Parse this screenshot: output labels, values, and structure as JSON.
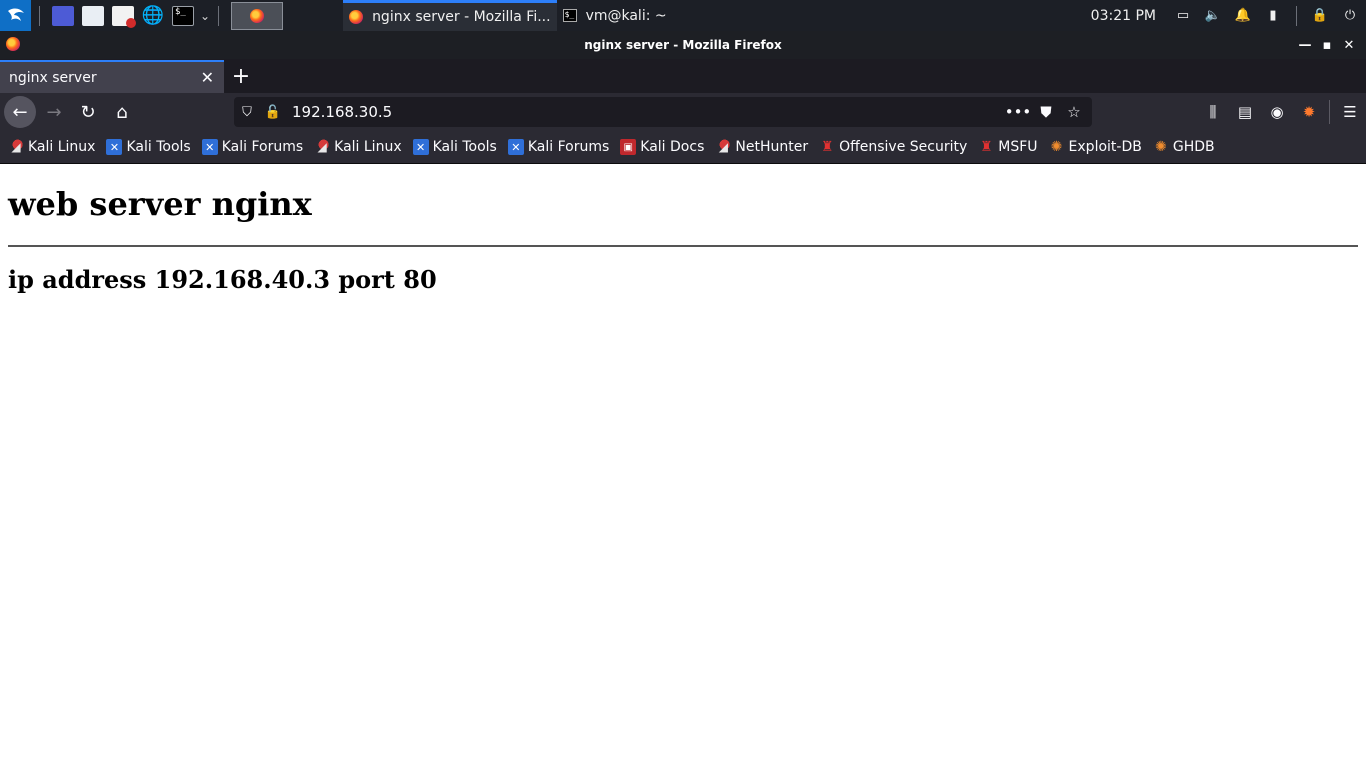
{
  "taskbar": {
    "tasks": [
      {
        "label": "nginx server - Mozilla Fi...",
        "icon": "firefox-icon",
        "active": true
      },
      {
        "label": "vm@kali: ~",
        "icon": "terminal-icon",
        "active": false
      }
    ],
    "clock": "03:21 PM",
    "accent_color": "#2d7ff9"
  },
  "window": {
    "title": "nginx server - Mozilla Firefox"
  },
  "tabs": [
    {
      "label": "nginx server"
    }
  ],
  "navbar": {
    "url": "192.168.30.5"
  },
  "bookmarks": [
    {
      "label": "Kali Linux",
      "icon": "kali-icon"
    },
    {
      "label": "Kali Tools",
      "icon": "kali-tools-icon"
    },
    {
      "label": "Kali Forums",
      "icon": "kali-tools-icon"
    },
    {
      "label": "Kali Linux",
      "icon": "kali-icon"
    },
    {
      "label": "Kali Tools",
      "icon": "kali-tools-icon"
    },
    {
      "label": "Kali Forums",
      "icon": "kali-tools-icon"
    },
    {
      "label": "Kali Docs",
      "icon": "kali-docs-icon"
    },
    {
      "label": "NetHunter",
      "icon": "kali-icon"
    },
    {
      "label": "Offensive Security",
      "icon": "offsec-icon"
    },
    {
      "label": "MSFU",
      "icon": "offsec-icon"
    },
    {
      "label": "Exploit-DB",
      "icon": "exploitdb-icon"
    },
    {
      "label": "GHDB",
      "icon": "exploitdb-icon"
    }
  ],
  "page": {
    "heading": "web server nginx",
    "subheading": "ip address 192.168.40.3 port 80"
  }
}
